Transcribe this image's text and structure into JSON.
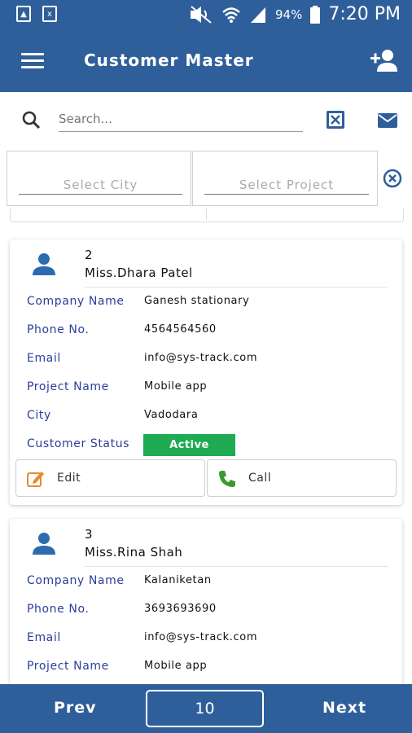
{
  "status_bar": {
    "battery": "94%",
    "time": "7:20 PM",
    "icons": [
      "gallery-icon",
      "excel-icon",
      "mute-icon",
      "wifi-icon",
      "signal-icon",
      "battery-icon"
    ]
  },
  "app_bar": {
    "title": "Customer Master",
    "menu_icon": "hamburger-icon",
    "add_icon": "add-user-icon"
  },
  "search": {
    "placeholder": "Search..."
  },
  "filters": {
    "city_placeholder": "Select City",
    "project_placeholder": "Select Project"
  },
  "labels": {
    "company": "Company Name",
    "phone": "Phone No.",
    "email": "Email",
    "project": "Project Name",
    "city": "City",
    "status": "Customer Status"
  },
  "customers": [
    {
      "number": "2",
      "name": "Miss.Dhara Patel",
      "company": "Ganesh stationary",
      "phone": "4564564560",
      "email": "info@sys-track.com",
      "project": "Mobile app",
      "city": "Vadodara",
      "status": "Active",
      "edit_label": "Edit",
      "call_label": "Call"
    },
    {
      "number": "3",
      "name": "Miss.Rina Shah",
      "company": "Kalaniketan",
      "phone": "3693693690",
      "email": "info@sys-track.com",
      "project": "Mobile app"
    }
  ],
  "pagination": {
    "prev_label": "Prev",
    "page_size": "10",
    "next_label": "Next"
  },
  "colors": {
    "primary": "#2f5f9a",
    "label": "#2a3f99",
    "active": "#1eab53",
    "edit_icon": "#e8892b",
    "call_icon": "#3a9a2e"
  }
}
